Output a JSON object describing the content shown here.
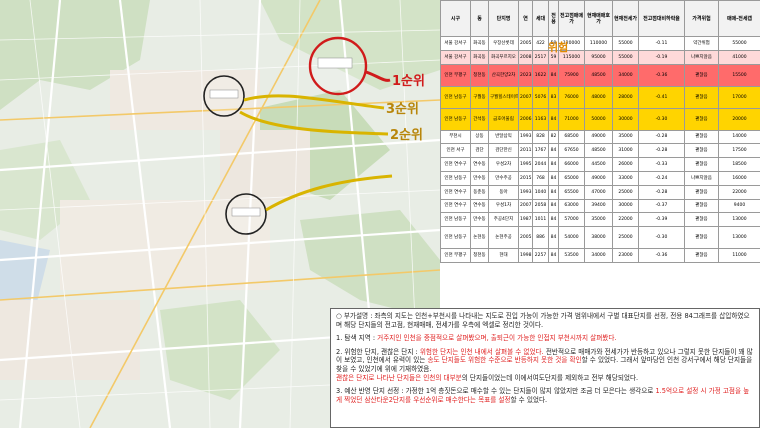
{
  "map": {
    "label_rank1": "1순위",
    "label_rank3": "3순위",
    "label_rank2": "2순위"
  },
  "risk_badge": "위험",
  "table": {
    "headers": [
      "시구",
      "동",
      "단지명",
      "연",
      "세대",
      "전용",
      "전고점매매가",
      "현재매매호가",
      "현재전세가",
      "전고점대비하락율",
      "가격위험",
      "매매-전세갭"
    ],
    "rows": [
      {
        "style": "hl-base",
        "cells": [
          "서울 강서구",
          "화곡동",
          "우장산롯데",
          "2005",
          "422",
          "59",
          "120000",
          "110000",
          "55000",
          "-0.11",
          "약간위험",
          "55000"
        ]
      },
      {
        "style": "hl-pink",
        "cells": [
          "서울 강서구",
          "화곡동",
          "화곡푸르지오",
          "2008",
          "2517",
          "59",
          "115000",
          "95000",
          "55000",
          "-0.19",
          "나쁘지않음",
          "41000"
        ]
      },
      {
        "style": "hl-red",
        "cells": [
          "인천 부평구",
          "청천동",
          "산곡한양2차",
          "2023",
          "1622",
          "84",
          "75900",
          "48500",
          "34000",
          "-0.36",
          "괜찮음",
          "15500"
        ]
      },
      {
        "style": "hl-yellow",
        "cells": [
          "인천 남동구",
          "구월동",
          "구월힐스테이트롯데캐슬",
          "2007",
          "5076",
          "83",
          "76000",
          "48000",
          "28000",
          "-0.41",
          "괜찮음",
          "17000"
        ]
      },
      {
        "style": "hl-yellow",
        "cells": [
          "인천 남동구",
          "간석동",
          "금호어울림",
          "2006",
          "1163",
          "84",
          "71000",
          "50000",
          "30000",
          "-0.30",
          "괜찮음",
          "20000"
        ]
      },
      {
        "style": "hl-base",
        "cells": [
          "부천시",
          "상동",
          "반달삼익",
          "1993",
          "828",
          "82",
          "68500",
          "49000",
          "35000",
          "-0.28",
          "괜찮음",
          "14000"
        ]
      },
      {
        "style": "hl-base",
        "cells": [
          "인천 서구",
          "검단",
          "검단한신",
          "2011",
          "1767",
          "84",
          "67650",
          "48500",
          "31000",
          "-0.28",
          "괜찮음",
          "17500"
        ]
      },
      {
        "style": "hl-base",
        "cells": [
          "인천 연수구",
          "연수동",
          "우성2차",
          "1995",
          "2044",
          "84",
          "66000",
          "44500",
          "26000",
          "-0.33",
          "괜찮음",
          "18500"
        ]
      },
      {
        "style": "hl-base",
        "cells": [
          "인천 남동구",
          "만수동",
          "만수주공",
          "2015",
          "768",
          "84",
          "65000",
          "49000",
          "33000",
          "-0.24",
          "나쁘지않음",
          "16000"
        ]
      },
      {
        "style": "hl-base",
        "cells": [
          "인천 연수구",
          "동춘동",
          "동아",
          "1993",
          "1040",
          "84",
          "65500",
          "47000",
          "25000",
          "-0.28",
          "괜찮음",
          "22000"
        ]
      },
      {
        "style": "hl-base",
        "cells": [
          "인천 연수구",
          "연수동",
          "우성1차",
          "2007",
          "2058",
          "84",
          "63000",
          "39400",
          "30000",
          "-0.37",
          "괜찮음",
          "9400"
        ]
      },
      {
        "style": "hl-base",
        "cells": [
          "인천 남동구",
          "만수동",
          "주공4단지",
          "1987",
          "1011",
          "84",
          "57000",
          "35000",
          "22000",
          "-0.39",
          "괜찮음",
          "13000"
        ]
      },
      {
        "style": "hl-base",
        "cells": [
          "인천 남동구",
          "논현동",
          "논현주공",
          "2005",
          "886",
          "84",
          "54000",
          "38000",
          "25000",
          "-0.30",
          "괜찮음",
          "13000"
        ]
      },
      {
        "style": "hl-base",
        "cells": [
          "인천 부평구",
          "청천동",
          "현대",
          "1998",
          "2257",
          "84",
          "53500",
          "34000",
          "23000",
          "-0.36",
          "괜찮음",
          "11000"
        ]
      }
    ]
  },
  "note": {
    "p1": "○ 부가설명 : 좌측의 지도는 인천+부천시를 나타내는 지도로 진입 가능이 가능한 가격 범위내에서 구별 대표단지를 선정, 전용 84그래프를 삽입하였으며 해당 단지들의 전고점, 현재매매, 전세가를 우측에 엑셀로 정리한 것이다.",
    "p2a": "1. 탐색 지역 : ",
    "p2b": "거주지인 인천을 중점적으로 살펴봤으며, 출퇴근이 가능한 인접지 부천시까지 살펴봤다.",
    "p3a": "2. 위험한 단지, 괜찮은 단지 : ",
    "p3b": "위험한 단지는 인천 내에서 살펴볼 수 없었다.",
    "p3c": " 전반적으로 매매가와 전세가가 반등하고 있으나 그렇지 못한 단지들이 꽤 많이 보였고, 인천에서 유력이 있는 ",
    "p3d": "송도 단지들도 위험한 수준으로 반등하지 못한 것을 확인",
    "p3e": "할 수 있었다. 그래서 앞마당인 인천 강서구에서 해당 단지들을 찾을 수 있었기에 위에 기재하였음.",
    "p3f": "괜찮은 단지로 나타난 단지들은 인천의 대부분",
    "p3g": "의 단지들이었는데 이에서여도단지를 제외하고 전부 해당되었다.",
    "p4a": "3. 예산 반영 단지 선정 : 가정한 1억 층짓돈으로 매수할 수 있는 단지들이 많지 않았지만 조금 더 모은다는 생각으로 ",
    "p4b": "1.5억으로 설정 시 가정 고점을 높게 찍었던 삼산타운2단지를 우선순위로 매수한다는 목표를 설정",
    "p4c": "할 수 있었다."
  }
}
